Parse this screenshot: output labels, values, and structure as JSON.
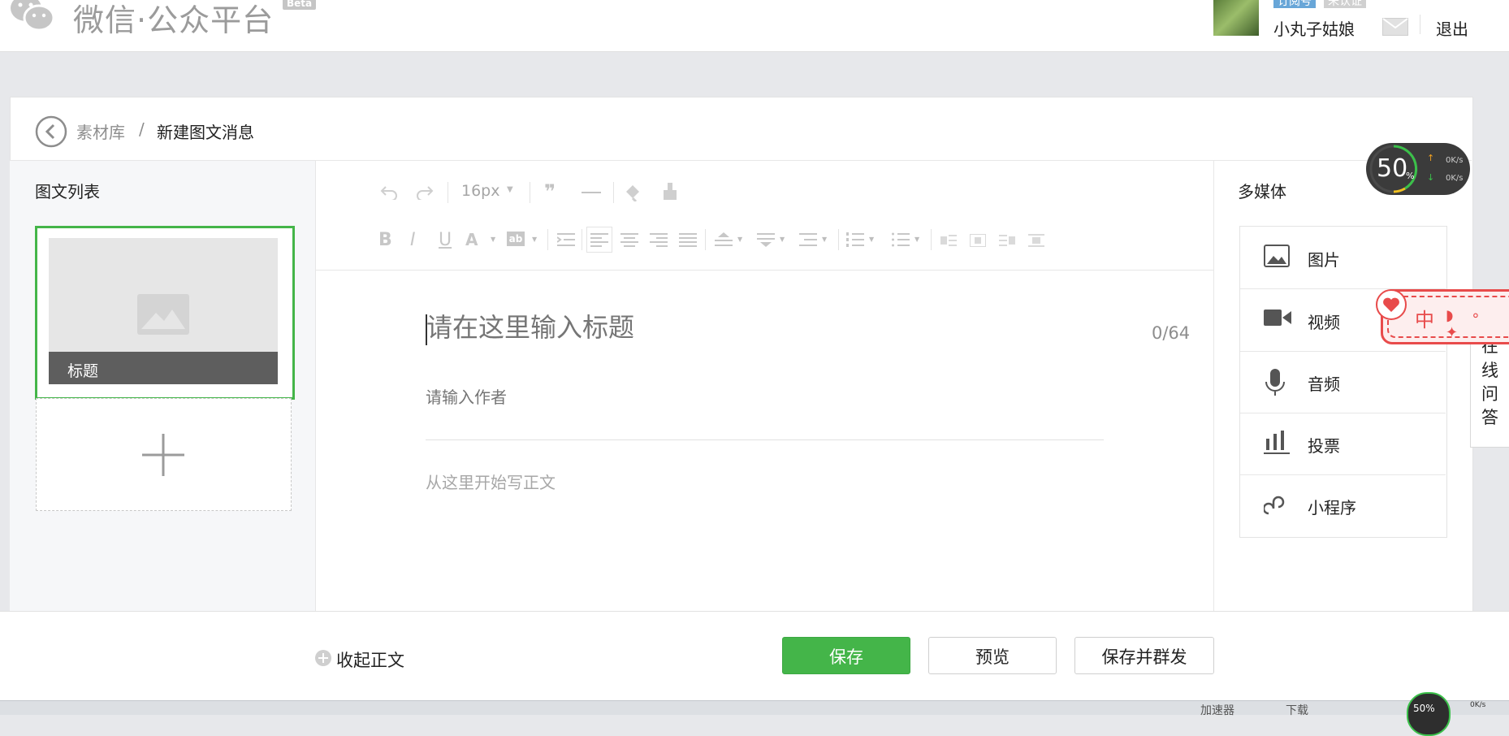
{
  "header": {
    "logo_text": "微信·公众平台",
    "beta": "Beta",
    "account_type": "订阅号",
    "verify_status": "未认证",
    "username": "小丸子姑娘",
    "logout": "退出",
    "icons": [
      "wechat-logo-icon",
      "mail-icon"
    ]
  },
  "breadcrumb": {
    "parent": "素材库",
    "separator": "/",
    "current": "新建图文消息"
  },
  "article_list": {
    "title": "图文列表",
    "items": [
      {
        "title": "标题"
      }
    ]
  },
  "toolbar": {
    "font_size": "16px",
    "icons_row1": [
      "undo-icon",
      "redo-icon",
      "font-size-dropdown",
      "blockquote-icon",
      "horizontal-rule-icon",
      "format-brush-icon",
      "clear-format-icon"
    ],
    "icons_row2": [
      "bold-icon",
      "italic-icon",
      "underline-icon",
      "font-color-icon",
      "highlight-icon",
      "indent-icon",
      "align-left-icon",
      "align-center-icon",
      "align-right-icon",
      "align-justify-icon",
      "spacing-before-icon",
      "spacing-after-icon",
      "line-height-icon",
      "ordered-list-icon",
      "unordered-list-icon",
      "float-left-icon",
      "float-none-icon",
      "float-right-icon",
      "float-center-icon"
    ]
  },
  "editor": {
    "title_placeholder": "请在这里输入标题",
    "title_counter": "0/64",
    "author_placeholder": "请输入作者",
    "body_placeholder": "从这里开始写正文"
  },
  "media": {
    "title": "多媒体",
    "items": [
      {
        "label": "图片",
        "icon": "image-icon"
      },
      {
        "label": "视频",
        "icon": "video-icon"
      },
      {
        "label": "音频",
        "icon": "microphone-icon"
      },
      {
        "label": "投票",
        "icon": "vote-chart-icon"
      },
      {
        "label": "小程序",
        "icon": "mini-program-icon"
      }
    ]
  },
  "side_tab": {
    "chars": [
      "在",
      "线",
      "问",
      "答"
    ]
  },
  "sticker": {
    "text": "中"
  },
  "speed_widget": {
    "percent": "50",
    "percent_sign": "%",
    "upload": "0K/s",
    "download": "0K/s"
  },
  "bottom": {
    "collapse": "收起正文",
    "save": "保存",
    "preview": "预览",
    "save_publish": "保存并群发"
  },
  "statusbar": {
    "accelerator": "加速器",
    "download": "下载",
    "percent": "50%",
    "speed": "0K/s"
  },
  "colors": {
    "primary_green": "#44b549",
    "text_dark": "#222222",
    "placeholder": "#a7a7a7",
    "page_bg": "#e7e8eb"
  }
}
